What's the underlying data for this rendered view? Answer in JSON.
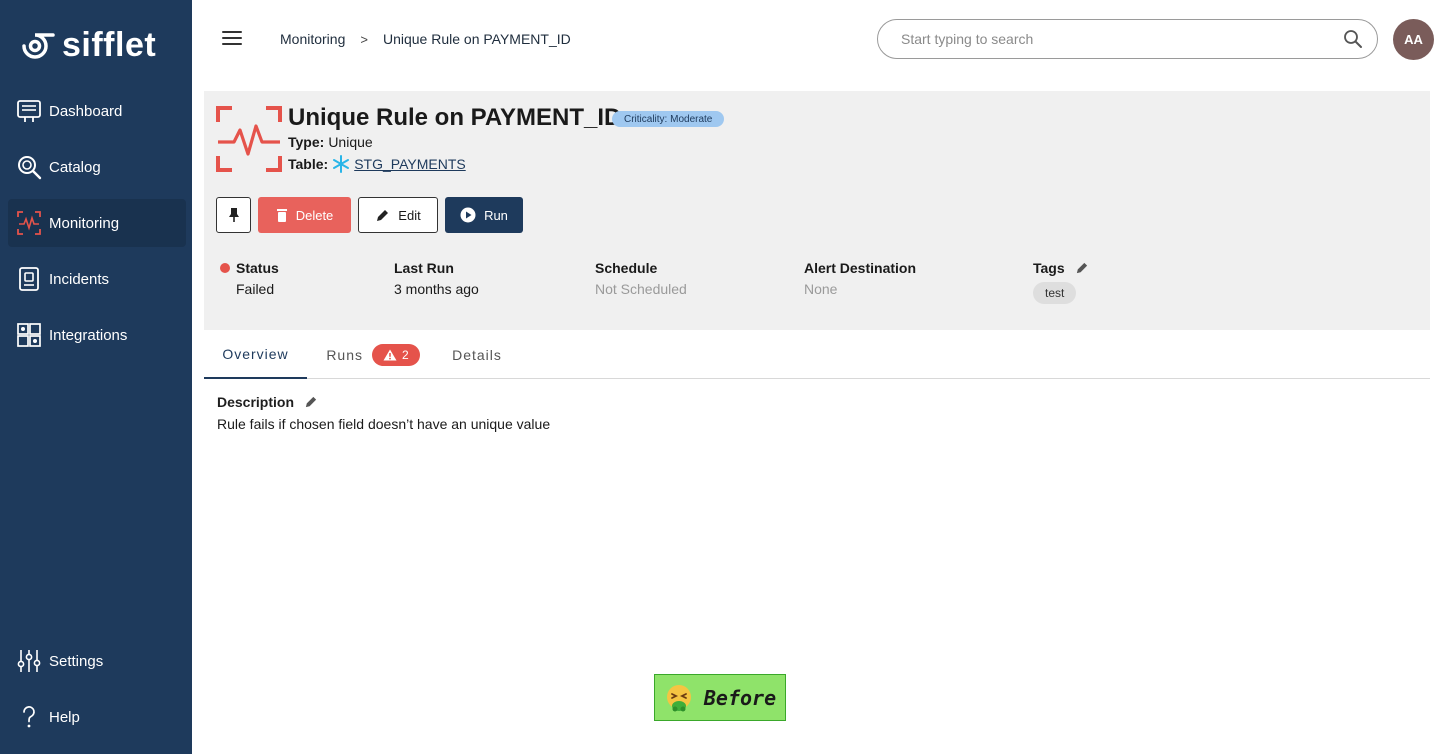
{
  "app": {
    "brand": "sifflet"
  },
  "sidebar": {
    "items": [
      {
        "label": "Dashboard",
        "icon": "dashboard-icon"
      },
      {
        "label": "Catalog",
        "icon": "catalog-search-icon"
      },
      {
        "label": "Monitoring",
        "icon": "monitoring-pulse-icon",
        "active": true
      },
      {
        "label": "Incidents",
        "icon": "incidents-icon"
      },
      {
        "label": "Integrations",
        "icon": "integrations-icon"
      }
    ],
    "bottom_items": [
      {
        "label": "Settings",
        "icon": "settings-sliders-icon"
      },
      {
        "label": "Help",
        "icon": "help-question-icon"
      }
    ]
  },
  "topbar": {
    "breadcrumb": [
      "Monitoring",
      "Unique Rule on PAYMENT_ID"
    ],
    "search_placeholder": "Start typing to search",
    "avatar_initials": "AA"
  },
  "rule": {
    "title": "Unique Rule on PAYMENT_ID",
    "criticality": "Criticality: Moderate",
    "type_label": "Type:",
    "type_value": "Unique",
    "table_label": "Table:",
    "table_value": "STG_PAYMENTS"
  },
  "actions": {
    "delete_label": "Delete",
    "edit_label": "Edit",
    "run_label": "Run"
  },
  "info": {
    "status": {
      "label": "Status",
      "value": "Failed"
    },
    "last_run": {
      "label": "Last Run",
      "value": "3 months ago"
    },
    "schedule": {
      "label": "Schedule",
      "value": "Not Scheduled"
    },
    "alert_destination": {
      "label": "Alert Destination",
      "value": "None"
    },
    "tags": {
      "label": "Tags",
      "values": [
        "test"
      ]
    }
  },
  "tabs": {
    "overview": "Overview",
    "runs": "Runs",
    "runs_count": "2",
    "details": "Details"
  },
  "description": {
    "title": "Description",
    "text": "Rule fails if chosen field doesn’t have an unique value"
  },
  "overlay": {
    "label": "Before"
  },
  "colors": {
    "sidebar_bg": "#1e3a5c",
    "accent_red": "#e5534b",
    "delete_red": "#e8625c",
    "criticality_blue": "#9fc8f0",
    "before_green": "#8fe36a"
  }
}
